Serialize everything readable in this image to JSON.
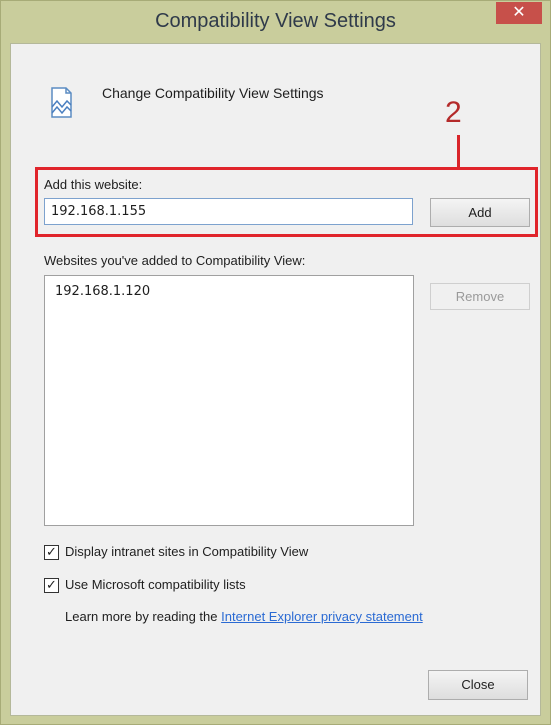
{
  "window": {
    "title": "Compatibility View Settings",
    "close_glyph": "✕",
    "close_color": "#c7504a",
    "frame_color": "#c9cd9c"
  },
  "header": {
    "icon": "compatibility-view-icon",
    "text": "Change Compatibility View Settings"
  },
  "annotation": {
    "number": "2",
    "color": "#e0242b"
  },
  "add_site": {
    "label": "Add this website:",
    "input_value": "192.168.1.155",
    "add_button": "Add"
  },
  "site_list": {
    "label": "Websites you've added to Compatibility View:",
    "items": [
      "192.168.1.120"
    ],
    "remove_button": "Remove",
    "remove_enabled": false
  },
  "options": [
    {
      "label": "Display intranet sites in Compatibility View",
      "checked": true
    },
    {
      "label": "Use Microsoft compatibility lists",
      "checked": true
    }
  ],
  "learn_more": {
    "prefix": "Learn more by reading the ",
    "link": "Internet Explorer privacy statement",
    "link_color": "#2a6ad3"
  },
  "footer": {
    "close_button": "Close"
  }
}
